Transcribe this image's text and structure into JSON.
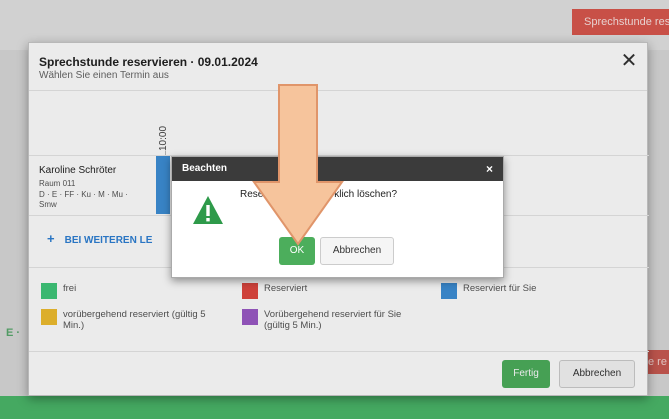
{
  "background": {
    "top_button_label": "Sprechstunde res",
    "left_fragment": "E ·",
    "right_button_fragment": "e re"
  },
  "modal": {
    "title": "Sprechstunde reservieren · 09.01.2024",
    "subtitle": "Wählen Sie einen Termin aus",
    "close_label": "✕",
    "time_label": "10:00",
    "person": {
      "name": "Karoline Schröter",
      "room": "Raum 011",
      "subjects": "D · E · FF · Ku · M · Mu ·",
      "extra": "Smw"
    },
    "more_link_label": "BEI WEITEREN LE",
    "legend": [
      {
        "label": "frei",
        "color": "#3fc77a"
      },
      {
        "label": "Reserviert",
        "color": "#e0473f"
      },
      {
        "label": "Reserviert für Sie",
        "color": "#3d8fd6"
      },
      {
        "label": "vorübergehend reserviert (gültig 5 Min.)",
        "color": "#efbd2f"
      },
      {
        "label": "Vorübergehend reserviert für Sie (gültig 5 Min.)",
        "color": "#9b59c6"
      }
    ],
    "done_label": "Fertig",
    "cancel_label": "Abbrechen"
  },
  "confirm": {
    "title": "Beachten",
    "close_label": "×",
    "message_start": "Reserv",
    "message_end": "virklich löschen?",
    "ok_label": "OK",
    "cancel_label": "Abbrechen"
  },
  "colors": {
    "accent_green": "#4cae5c",
    "reserved_blue": "#3d8fd6",
    "arrow_fill": "#f6c49c",
    "arrow_stroke": "#e0956a"
  }
}
